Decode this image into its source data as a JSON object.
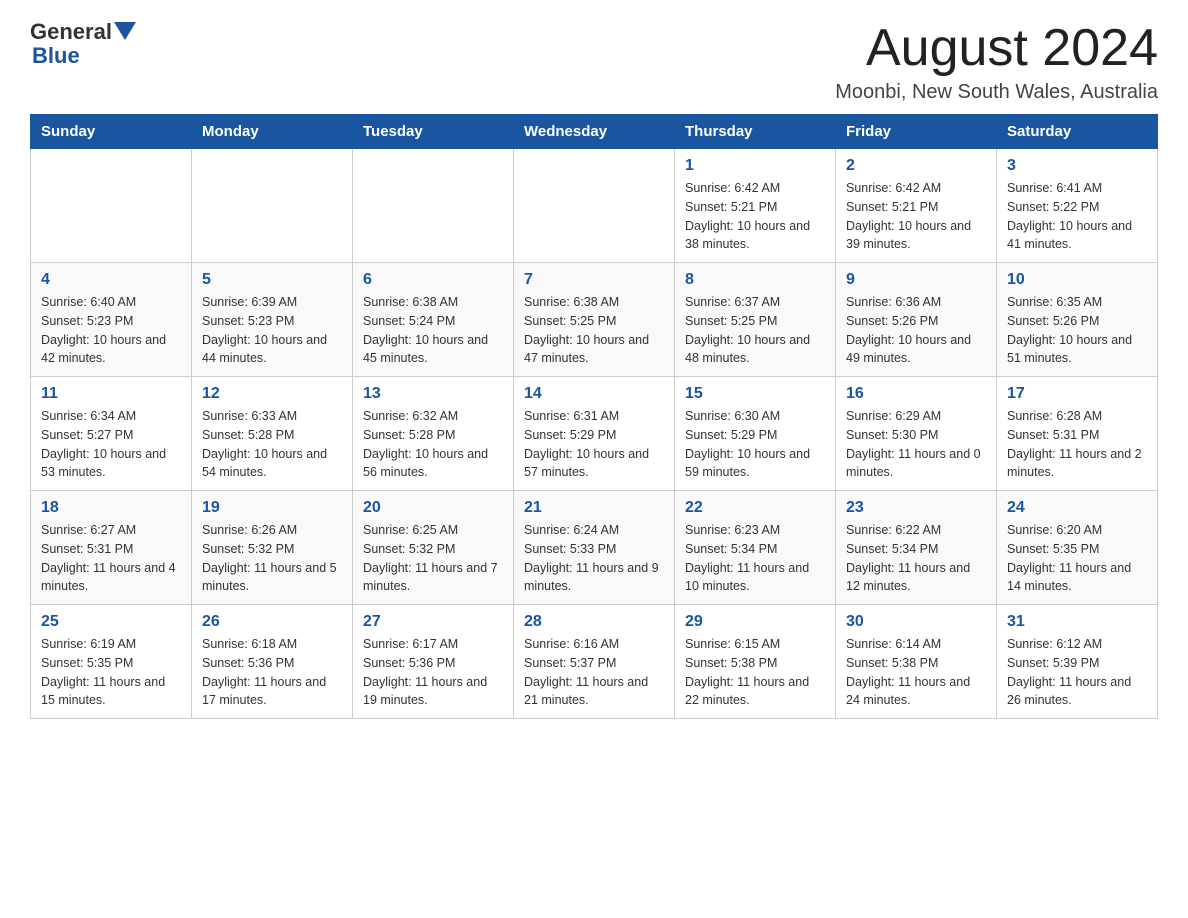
{
  "header": {
    "logo_general": "General",
    "logo_blue": "Blue",
    "title": "August 2024",
    "subtitle": "Moonbi, New South Wales, Australia"
  },
  "calendar": {
    "days_of_week": [
      "Sunday",
      "Monday",
      "Tuesday",
      "Wednesday",
      "Thursday",
      "Friday",
      "Saturday"
    ],
    "weeks": [
      [
        {
          "day": "",
          "info": ""
        },
        {
          "day": "",
          "info": ""
        },
        {
          "day": "",
          "info": ""
        },
        {
          "day": "",
          "info": ""
        },
        {
          "day": "1",
          "info": "Sunrise: 6:42 AM\nSunset: 5:21 PM\nDaylight: 10 hours and 38 minutes."
        },
        {
          "day": "2",
          "info": "Sunrise: 6:42 AM\nSunset: 5:21 PM\nDaylight: 10 hours and 39 minutes."
        },
        {
          "day": "3",
          "info": "Sunrise: 6:41 AM\nSunset: 5:22 PM\nDaylight: 10 hours and 41 minutes."
        }
      ],
      [
        {
          "day": "4",
          "info": "Sunrise: 6:40 AM\nSunset: 5:23 PM\nDaylight: 10 hours and 42 minutes."
        },
        {
          "day": "5",
          "info": "Sunrise: 6:39 AM\nSunset: 5:23 PM\nDaylight: 10 hours and 44 minutes."
        },
        {
          "day": "6",
          "info": "Sunrise: 6:38 AM\nSunset: 5:24 PM\nDaylight: 10 hours and 45 minutes."
        },
        {
          "day": "7",
          "info": "Sunrise: 6:38 AM\nSunset: 5:25 PM\nDaylight: 10 hours and 47 minutes."
        },
        {
          "day": "8",
          "info": "Sunrise: 6:37 AM\nSunset: 5:25 PM\nDaylight: 10 hours and 48 minutes."
        },
        {
          "day": "9",
          "info": "Sunrise: 6:36 AM\nSunset: 5:26 PM\nDaylight: 10 hours and 49 minutes."
        },
        {
          "day": "10",
          "info": "Sunrise: 6:35 AM\nSunset: 5:26 PM\nDaylight: 10 hours and 51 minutes."
        }
      ],
      [
        {
          "day": "11",
          "info": "Sunrise: 6:34 AM\nSunset: 5:27 PM\nDaylight: 10 hours and 53 minutes."
        },
        {
          "day": "12",
          "info": "Sunrise: 6:33 AM\nSunset: 5:28 PM\nDaylight: 10 hours and 54 minutes."
        },
        {
          "day": "13",
          "info": "Sunrise: 6:32 AM\nSunset: 5:28 PM\nDaylight: 10 hours and 56 minutes."
        },
        {
          "day": "14",
          "info": "Sunrise: 6:31 AM\nSunset: 5:29 PM\nDaylight: 10 hours and 57 minutes."
        },
        {
          "day": "15",
          "info": "Sunrise: 6:30 AM\nSunset: 5:29 PM\nDaylight: 10 hours and 59 minutes."
        },
        {
          "day": "16",
          "info": "Sunrise: 6:29 AM\nSunset: 5:30 PM\nDaylight: 11 hours and 0 minutes."
        },
        {
          "day": "17",
          "info": "Sunrise: 6:28 AM\nSunset: 5:31 PM\nDaylight: 11 hours and 2 minutes."
        }
      ],
      [
        {
          "day": "18",
          "info": "Sunrise: 6:27 AM\nSunset: 5:31 PM\nDaylight: 11 hours and 4 minutes."
        },
        {
          "day": "19",
          "info": "Sunrise: 6:26 AM\nSunset: 5:32 PM\nDaylight: 11 hours and 5 minutes."
        },
        {
          "day": "20",
          "info": "Sunrise: 6:25 AM\nSunset: 5:32 PM\nDaylight: 11 hours and 7 minutes."
        },
        {
          "day": "21",
          "info": "Sunrise: 6:24 AM\nSunset: 5:33 PM\nDaylight: 11 hours and 9 minutes."
        },
        {
          "day": "22",
          "info": "Sunrise: 6:23 AM\nSunset: 5:34 PM\nDaylight: 11 hours and 10 minutes."
        },
        {
          "day": "23",
          "info": "Sunrise: 6:22 AM\nSunset: 5:34 PM\nDaylight: 11 hours and 12 minutes."
        },
        {
          "day": "24",
          "info": "Sunrise: 6:20 AM\nSunset: 5:35 PM\nDaylight: 11 hours and 14 minutes."
        }
      ],
      [
        {
          "day": "25",
          "info": "Sunrise: 6:19 AM\nSunset: 5:35 PM\nDaylight: 11 hours and 15 minutes."
        },
        {
          "day": "26",
          "info": "Sunrise: 6:18 AM\nSunset: 5:36 PM\nDaylight: 11 hours and 17 minutes."
        },
        {
          "day": "27",
          "info": "Sunrise: 6:17 AM\nSunset: 5:36 PM\nDaylight: 11 hours and 19 minutes."
        },
        {
          "day": "28",
          "info": "Sunrise: 6:16 AM\nSunset: 5:37 PM\nDaylight: 11 hours and 21 minutes."
        },
        {
          "day": "29",
          "info": "Sunrise: 6:15 AM\nSunset: 5:38 PM\nDaylight: 11 hours and 22 minutes."
        },
        {
          "day": "30",
          "info": "Sunrise: 6:14 AM\nSunset: 5:38 PM\nDaylight: 11 hours and 24 minutes."
        },
        {
          "day": "31",
          "info": "Sunrise: 6:12 AM\nSunset: 5:39 PM\nDaylight: 11 hours and 26 minutes."
        }
      ]
    ]
  }
}
